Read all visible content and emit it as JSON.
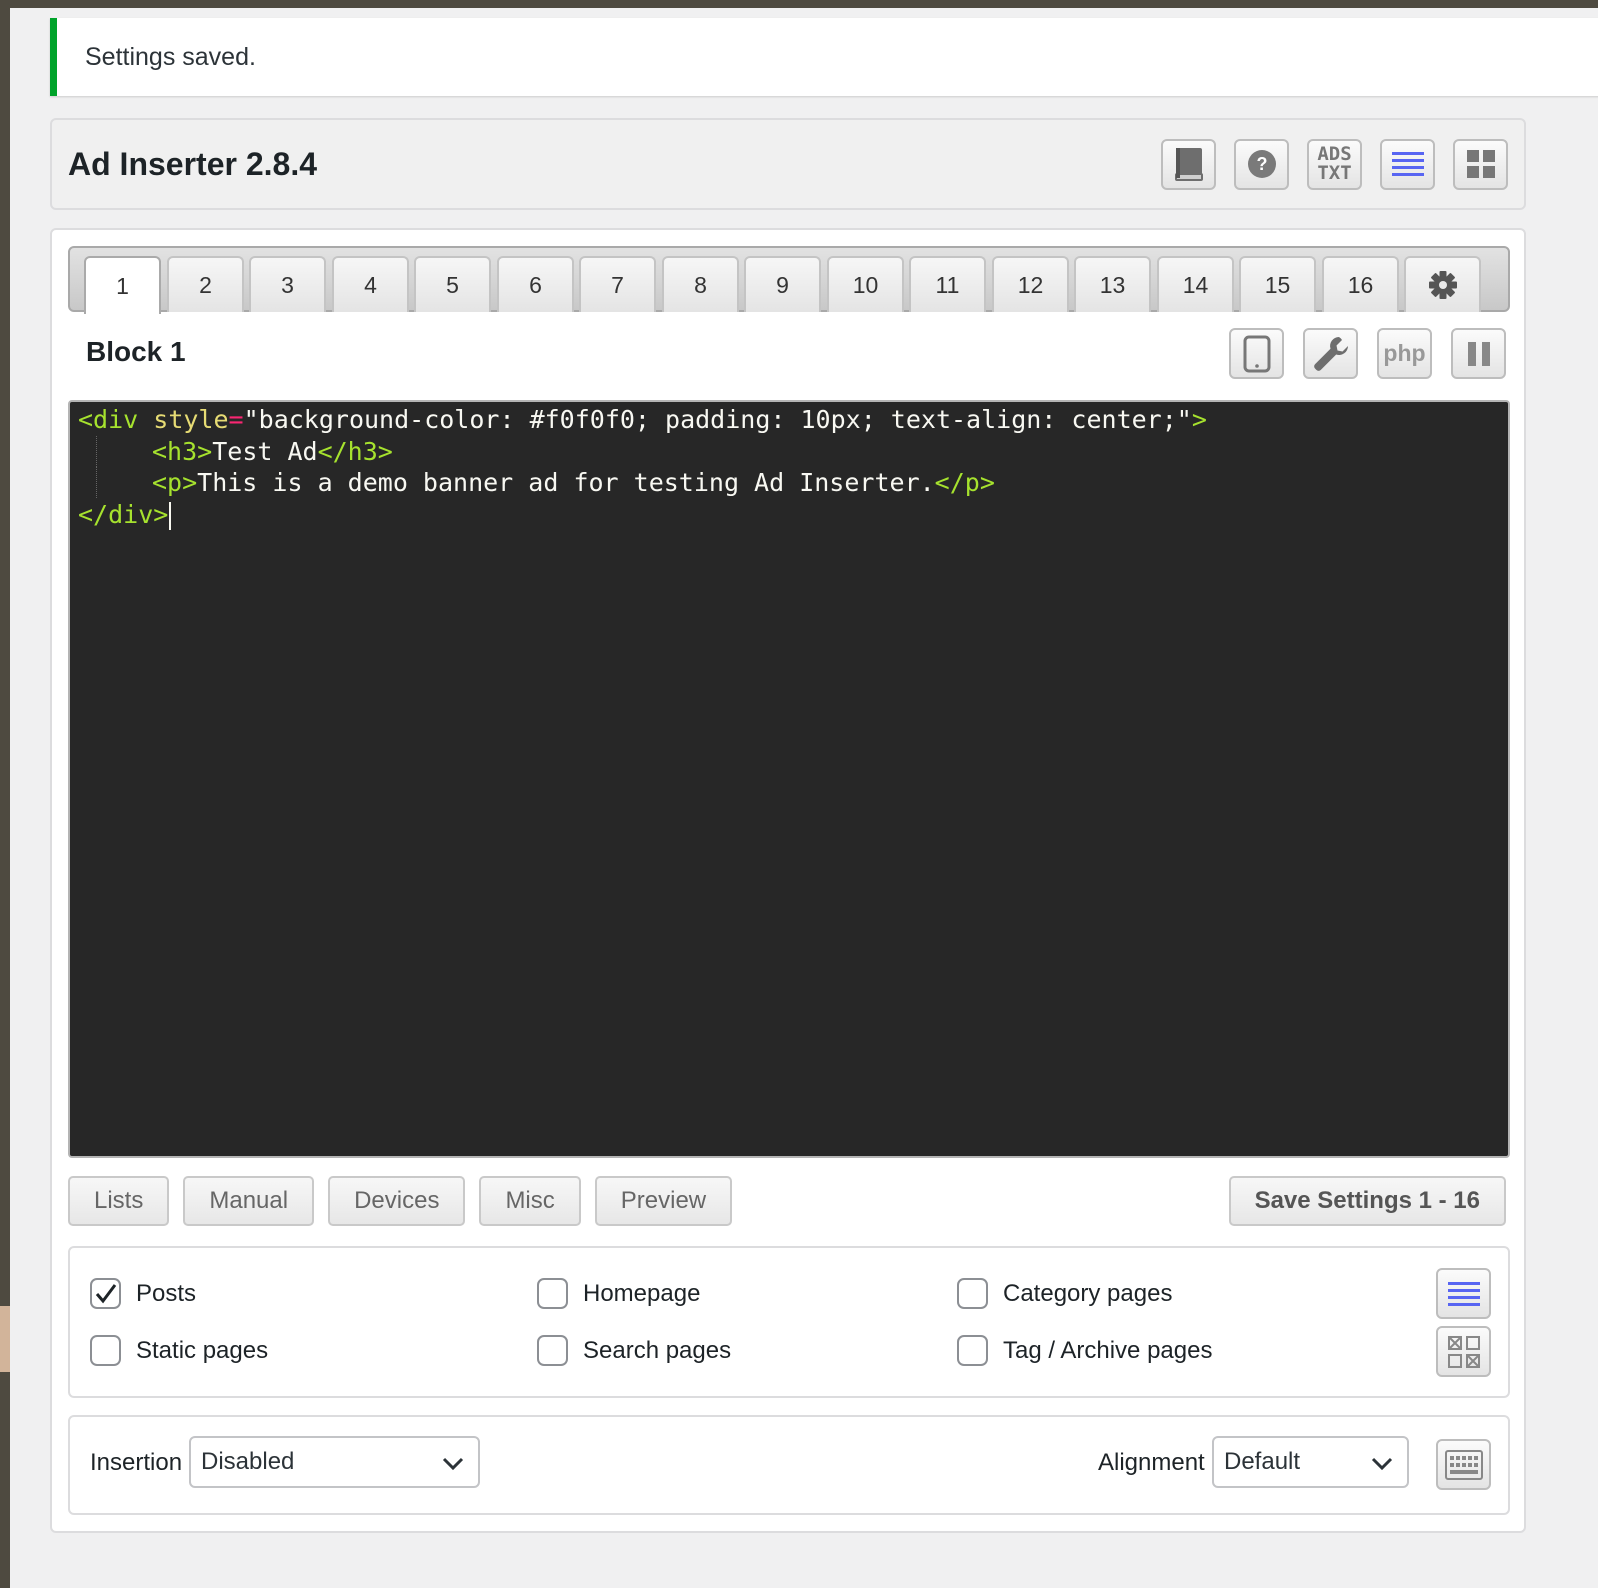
{
  "notice": {
    "text": "Settings saved."
  },
  "header": {
    "title": "Ad Inserter 2.8.4",
    "icons": [
      "book-icon",
      "help-icon",
      "ads-txt-icon",
      "list-icon",
      "grid-icon"
    ],
    "ads_txt_line1": "ADS",
    "ads_txt_line2": "TXT"
  },
  "tabs": [
    "1",
    "2",
    "3",
    "4",
    "5",
    "6",
    "7",
    "8",
    "9",
    "10",
    "11",
    "12",
    "13",
    "14",
    "15",
    "16"
  ],
  "active_tab": "1",
  "block": {
    "title": "Block 1",
    "php_label": "php"
  },
  "code": {
    "l1_open": "<div",
    "l1_attr": " style",
    "l1_eq": "=",
    "l1_str": "\"background-color: #f0f0f0; padding: 10px; text-align: center;\"",
    "l1_close": ">",
    "l2_open": "<h3>",
    "l2_text": "Test Ad",
    "l2_close": "</h3>",
    "l3_open": "<p>",
    "l3_text": "This is a demo banner ad for testing Ad Inserter.",
    "l3_close": "</p>",
    "l4_close": "</div>"
  },
  "toolbar": {
    "lists": "Lists",
    "manual": "Manual",
    "devices": "Devices",
    "misc": "Misc",
    "preview": "Preview",
    "save": "Save Settings 1 - 16"
  },
  "lists": {
    "posts": "Posts",
    "homepage": "Homepage",
    "category": "Category pages",
    "static": "Static pages",
    "search": "Search pages",
    "tag": "Tag / Archive pages"
  },
  "checked": {
    "posts": true,
    "homepage": false,
    "category": false,
    "static": false,
    "search": false,
    "tag": false
  },
  "insertion": {
    "label": "Insertion",
    "value": "Disabled"
  },
  "alignment": {
    "label": "Alignment",
    "value": "Default"
  },
  "colors": {
    "accent": "#5865f2",
    "notice_border": "#00a32a",
    "editor_bg": "#272727",
    "tag": "#a6e22e"
  }
}
